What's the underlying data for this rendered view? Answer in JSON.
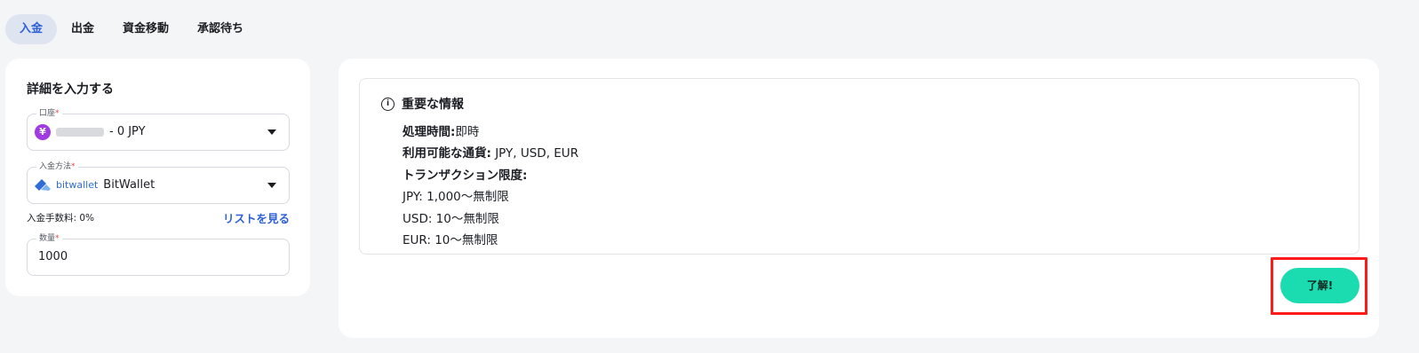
{
  "tabs": [
    {
      "label": "入金",
      "active": true
    },
    {
      "label": "出金",
      "active": false
    },
    {
      "label": "資金移動",
      "active": false
    },
    {
      "label": "承認待ち",
      "active": false
    }
  ],
  "form": {
    "title": "詳細を入力する",
    "account": {
      "label": "口座",
      "required_mark": "*",
      "currency_icon": "¥",
      "value": "- 0 JPY"
    },
    "method": {
      "label": "入金方法",
      "required_mark": "*",
      "logo_text": "bitwallet",
      "value": "BitWallet"
    },
    "fee": {
      "text": "入金手数料: 0%",
      "link": "リストを見る"
    },
    "amount": {
      "label": "数量",
      "required_mark": "*",
      "value": "1000"
    }
  },
  "info": {
    "title": "重要な情報",
    "processing_label": "処理時間:",
    "processing_value": "即時",
    "currencies_label": "利用可能な通貨:",
    "currencies_value": " JPY, USD, EUR",
    "limits_label": "トランザクション限度:",
    "limits": [
      "JPY: 1,000〜無制限",
      "USD: 10〜無制限",
      "EUR: 10〜無制限"
    ]
  },
  "confirm_button": "了解!",
  "colors": {
    "accent": "#2b5fd8",
    "button": "#1bdcb1",
    "highlight": "#ff1a1a",
    "required": "#e5484d"
  }
}
